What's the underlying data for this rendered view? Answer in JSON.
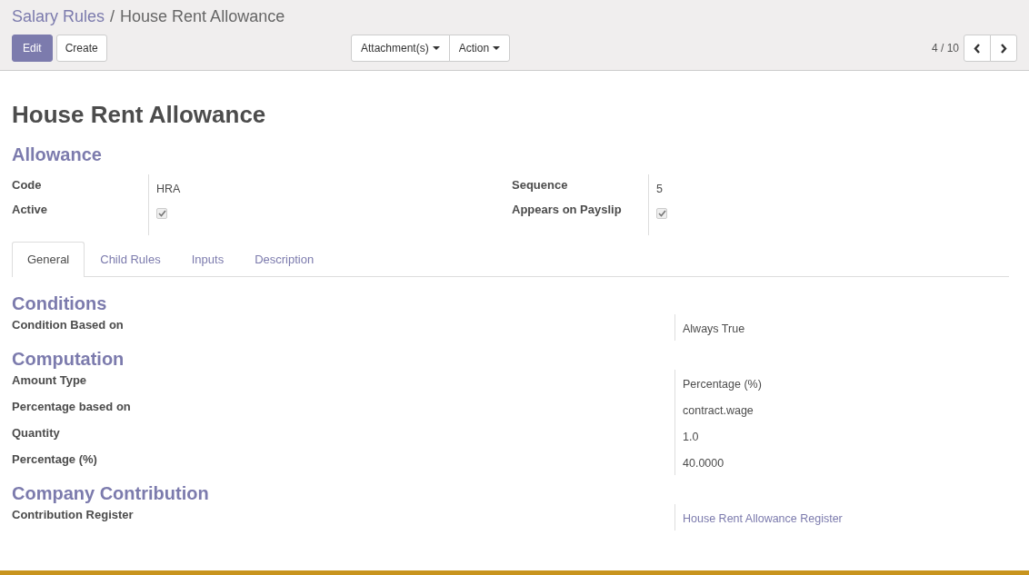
{
  "breadcrumb": {
    "parent": "Salary Rules",
    "separator": "/",
    "current": "House Rent Allowance"
  },
  "buttons": {
    "edit": "Edit",
    "create": "Create",
    "attachments": "Attachment(s)",
    "action": "Action"
  },
  "pager": {
    "value": "4 / 10"
  },
  "record": {
    "title": "House Rent Allowance",
    "category": "Allowance"
  },
  "header_fields": [
    {
      "label": "Code",
      "kind": "text",
      "value": "HRA"
    },
    {
      "label": "Sequence",
      "kind": "text",
      "value": "5"
    },
    {
      "label": "Active",
      "kind": "checkbox",
      "checked": true
    },
    {
      "label": "Appears on Payslip",
      "kind": "checkbox",
      "checked": true
    }
  ],
  "tabs": [
    {
      "label": "General",
      "selected": true
    },
    {
      "label": "Child Rules",
      "selected": false
    },
    {
      "label": "Inputs",
      "selected": false
    },
    {
      "label": "Description",
      "selected": false
    }
  ],
  "sections": [
    {
      "title": "Conditions",
      "fields": [
        {
          "label": "Condition Based on",
          "kind": "text",
          "value": "Always True"
        }
      ]
    },
    {
      "title": "Computation",
      "fields": [
        {
          "label": "Amount Type",
          "kind": "text",
          "value": "Percentage (%)"
        },
        {
          "label": "Percentage based on",
          "kind": "text",
          "value": "contract.wage"
        },
        {
          "label": "Quantity",
          "kind": "text",
          "value": "1.0"
        },
        {
          "label": "Percentage (%)",
          "kind": "text",
          "value": "40.0000"
        }
      ]
    },
    {
      "title": "Company Contribution",
      "fields": [
        {
          "label": "Contribution Register",
          "kind": "link",
          "value": "House Rent Allowance Register"
        }
      ]
    }
  ]
}
